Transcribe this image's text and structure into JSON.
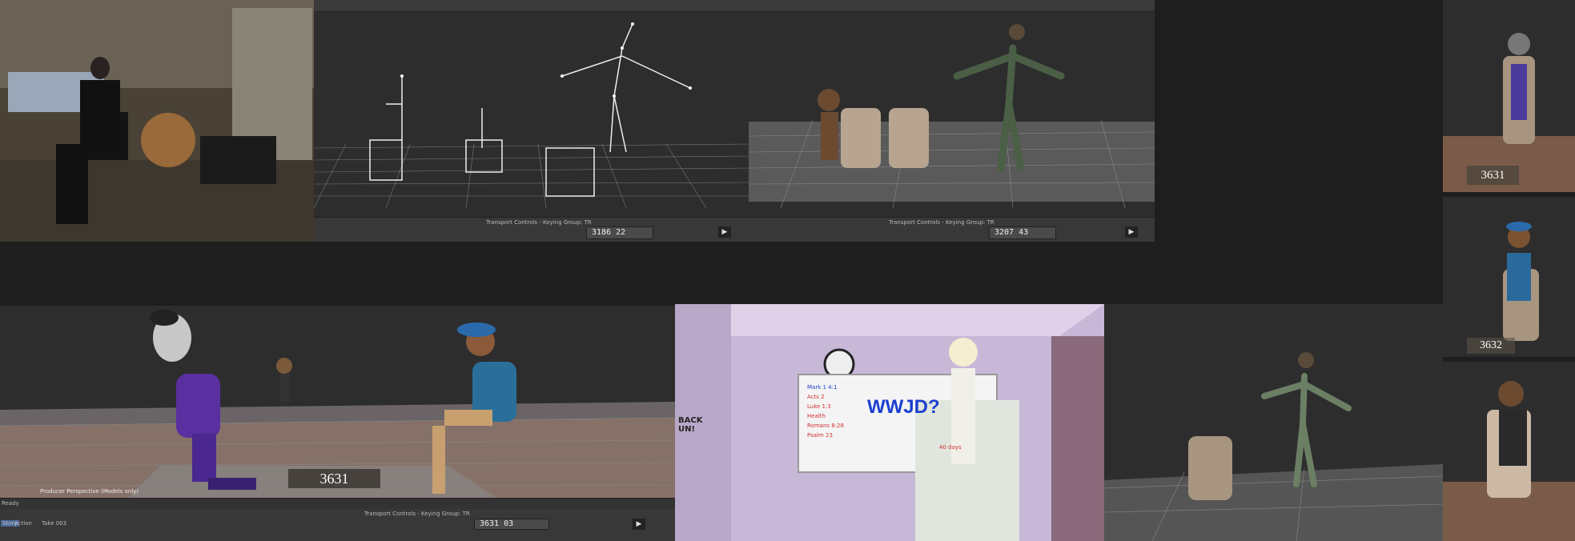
{
  "viewports": {
    "top_center": {
      "transport_title": "Transport Controls - Keying Group: TR",
      "frame": "3186",
      "subframe": "22"
    },
    "top_right": {
      "transport_title": "Transport Controls - Keying Group: TR",
      "frame": "3207",
      "subframe": "43"
    },
    "bottom_left": {
      "camera_label": "Producer Perspective (Models only)",
      "badge": "3631",
      "status": "Ready",
      "transport_title": "Transport Controls - Keying Group: TR",
      "frame": "3631",
      "subframe": "03",
      "story_tab": "Story",
      "action_tab": "Action",
      "take": "Take 003"
    },
    "thumb1": {
      "badge": "3631"
    },
    "thumb2": {
      "badge": "3632"
    }
  },
  "whiteboard": {
    "headline": "WWJD?",
    "notes": [
      "Mark 1 4:1",
      "Acts 2",
      "Luke 1:3",
      "Health",
      "Romans 8:28",
      "Psalm 23"
    ],
    "side_note": "40 days"
  },
  "poster_text": "BACK UN!",
  "colors": {
    "viewport_bg": "#2d2d2d",
    "grid": "#8a8a8a",
    "skeleton": "#e8e8e8",
    "wall": "#c8b8d8",
    "whiteboard_ink": "#1c3fd0"
  }
}
